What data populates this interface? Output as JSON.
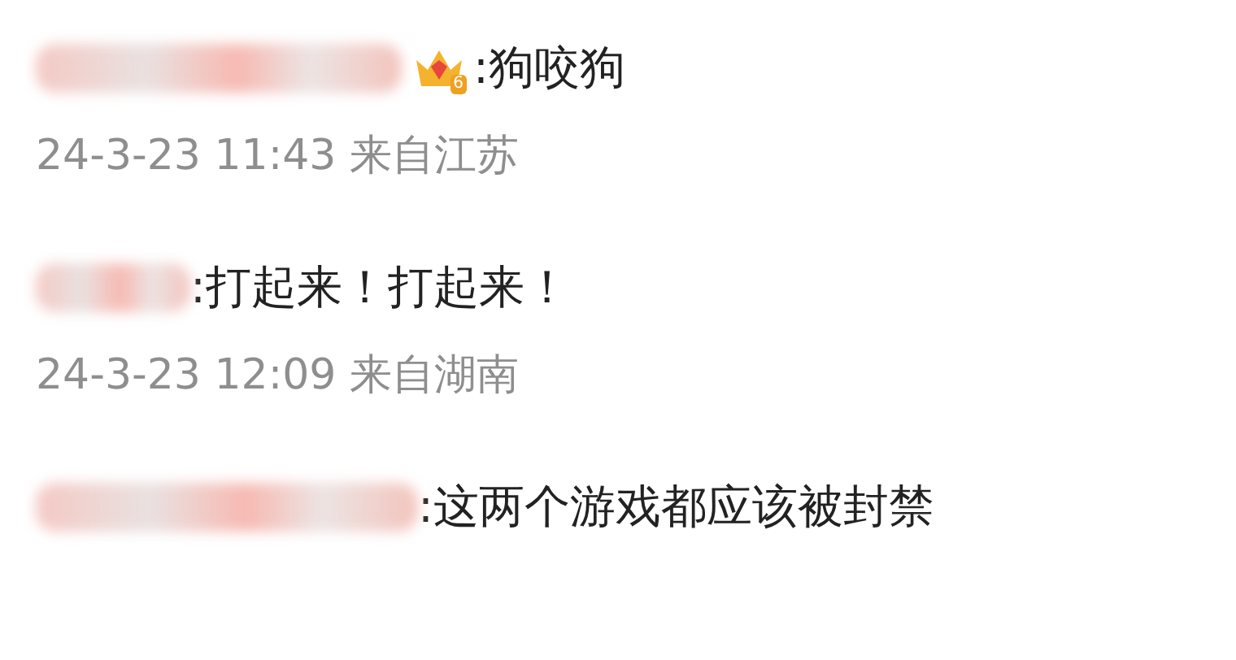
{
  "comments": [
    {
      "badge": {
        "level": "6"
      },
      "text": ":狗咬狗",
      "meta": "24-3-23 11:43 来自江苏"
    },
    {
      "text": ":打起来！打起来！",
      "meta": "24-3-23 12:09 来自湖南"
    },
    {
      "text": ":这两个游戏都应该被封禁"
    }
  ]
}
